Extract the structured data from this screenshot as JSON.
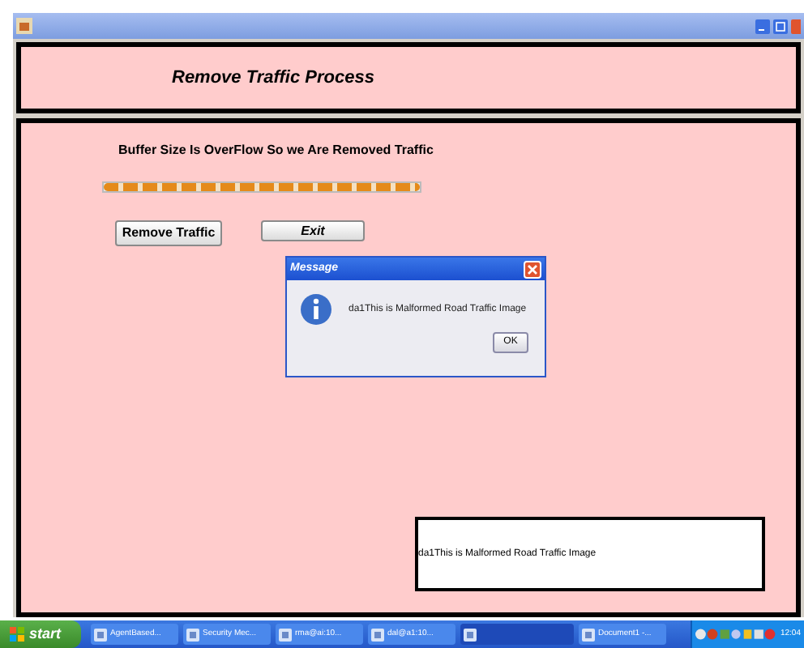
{
  "header": {
    "title": "Remove Traffic Process"
  },
  "main": {
    "message": "Buffer Size Is OverFlow So we Are Removed Traffic",
    "progress": {
      "level": 1
    },
    "buttons": [
      {
        "label": "Remove Traffic"
      },
      {
        "label": "Exit"
      }
    ],
    "output_box": {
      "text": "da1This is Malformed Road Traffic  Image"
    }
  },
  "dialog": {
    "title": "Message",
    "text": "da1This is Malformed Road Traffic Image",
    "button": "OK"
  },
  "taskbar": {
    "start": "start",
    "items": [
      {
        "label": "AgentBased...",
        "selected": false
      },
      {
        "label": "Security Mec...",
        "selected": false
      },
      {
        "label": "rma@ai:10...",
        "selected": false
      },
      {
        "label": "dal@a1:10...",
        "selected": false
      },
      {
        "selected": true
      },
      {
        "label": "Document1 -...",
        "selected": false
      }
    ],
    "clock": "12:04"
  }
}
